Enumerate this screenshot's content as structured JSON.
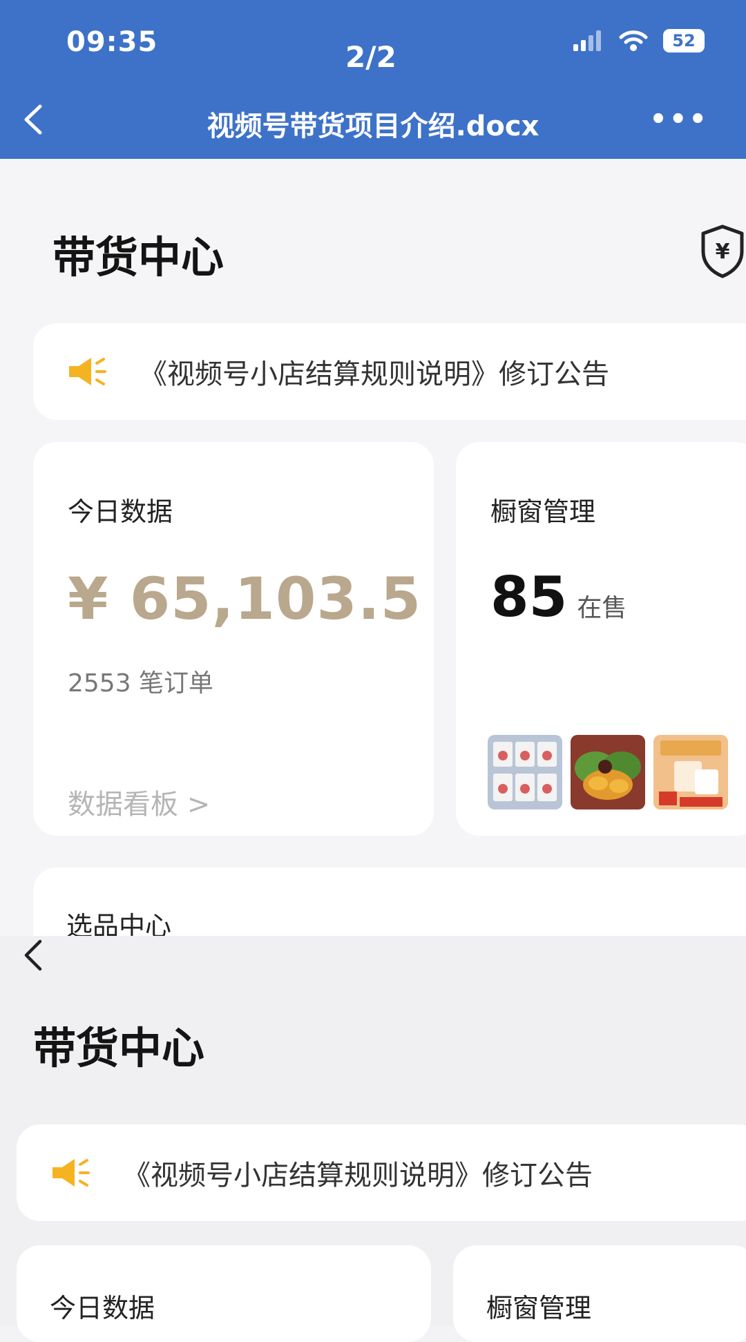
{
  "status_bar": {
    "time": "09:35",
    "page_indicator": "2/2",
    "battery": "52"
  },
  "doc_header": {
    "title": "视频号带货项目介绍.docx",
    "more": "•••"
  },
  "screen1": {
    "title": "带货中心",
    "notice": "《视频号小店结算规则说明》修订公告",
    "today": {
      "title": "今日数据",
      "amount": "¥ 65,103.5",
      "orders": "2553 笔订单",
      "link": "数据看板 >"
    },
    "showcase": {
      "title": "橱窗管理",
      "count": "85",
      "unit": "在售"
    },
    "selection": {
      "title": "选品中心"
    }
  },
  "screen2": {
    "title": "带货中心",
    "notice": "《视频号小店结算规则说明》修订公告",
    "today_title": "今日数据",
    "showcase_title": "橱窗管理"
  },
  "colors": {
    "header_blue": "#3d72c8",
    "amount_gold": "#b9a88d",
    "notice_icon": "#f5b322"
  },
  "icons": [
    "back-arrow-icon",
    "more-icon",
    "signal-icon",
    "wifi-icon",
    "battery-icon",
    "shield-yuan-icon",
    "megaphone-icon"
  ]
}
